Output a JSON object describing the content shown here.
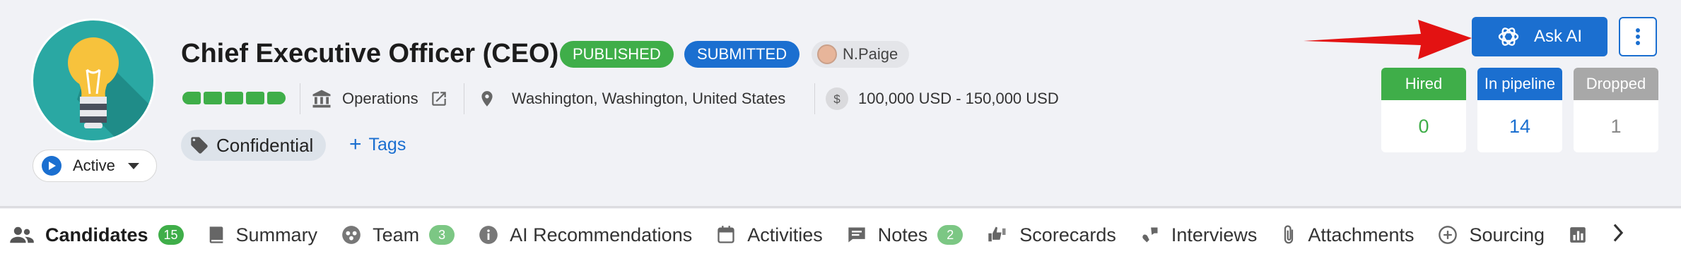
{
  "job": {
    "title": "Chief Executive Officer (CEO)",
    "status_badges": [
      "PUBLISHED",
      "SUBMITTED"
    ],
    "owner": "N.Paige",
    "department": "Operations",
    "location": "Washington, Washington, United States",
    "salary": "100,000 USD - 150,000 USD",
    "tag": "Confidential",
    "tags_link": "Tags",
    "state": "Active",
    "pipeline_progress": 1.0,
    "avatar_icon": "lightbulb-icon"
  },
  "actions": {
    "ask_ai": "Ask AI"
  },
  "stats": [
    {
      "label": "Hired",
      "value": "0",
      "color": "#3fae49"
    },
    {
      "label": "In pipeline",
      "value": "14",
      "color": "#1b6fd0"
    },
    {
      "label": "Dropped",
      "value": "1",
      "color": "#a8a8a8"
    }
  ],
  "tabs": [
    {
      "label": "Candidates",
      "count": "15",
      "icon": "people-icon"
    },
    {
      "label": "Summary",
      "icon": "book-icon"
    },
    {
      "label": "Team",
      "count": "3",
      "icon": "team-icon"
    },
    {
      "label": "AI Recommendations",
      "icon": "info-icon"
    },
    {
      "label": "Activities",
      "icon": "calendar-icon"
    },
    {
      "label": "Notes",
      "count": "2",
      "icon": "comment-icon"
    },
    {
      "label": "Scorecards",
      "icon": "thumbs-icon"
    },
    {
      "label": "Interviews",
      "icon": "interview-icon"
    },
    {
      "label": "Attachments",
      "icon": "paperclip-icon"
    },
    {
      "label": "Sourcing",
      "icon": "plus-circle-icon"
    }
  ],
  "colors": {
    "primary": "#1b6fd0",
    "success": "#3fae49",
    "arrow": "#e31212"
  }
}
